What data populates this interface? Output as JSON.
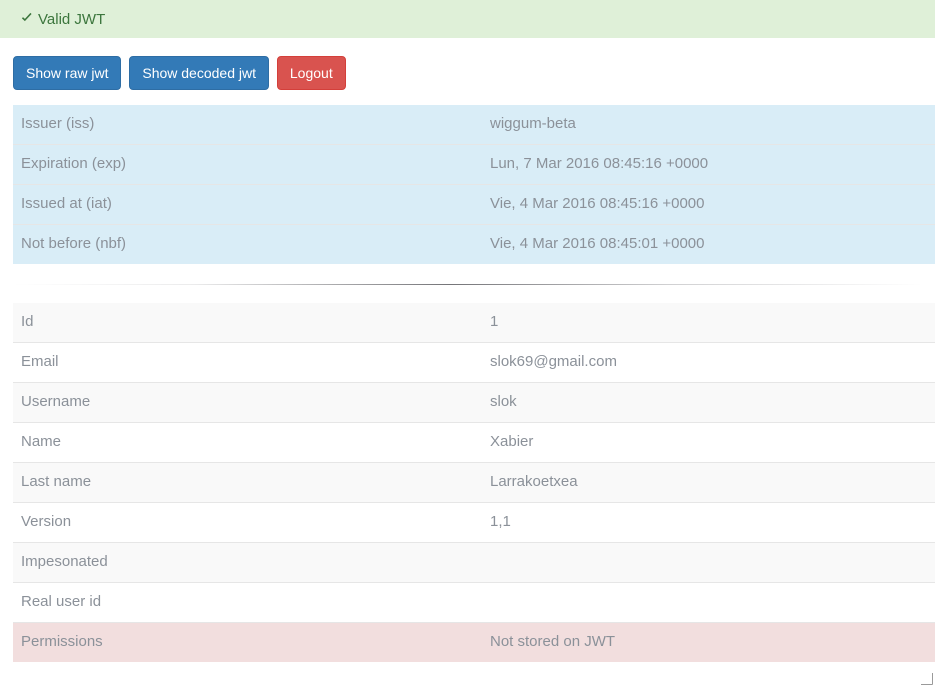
{
  "alert": {
    "icon": "check-icon",
    "text": "Valid JWT",
    "background_color": "#dff0d8",
    "text_color": "#3c763d"
  },
  "toolbar": {
    "show_raw_label": "Show raw jwt",
    "show_decoded_label": "Show decoded jwt",
    "logout_label": "Logout",
    "primary_color": "#337ab7",
    "danger_color": "#d9534f"
  },
  "claims_table": {
    "background_color": "#d9edf7",
    "rows": [
      {
        "label": "Issuer (iss)",
        "value": "wiggum-beta"
      },
      {
        "label": "Expiration (exp)",
        "value": "Lun, 7 Mar 2016 08:45:16 +0000"
      },
      {
        "label": "Issued at (iat)",
        "value": "Vie, 4 Mar 2016 08:45:16 +0000"
      },
      {
        "label": "Not before (nbf)",
        "value": "Vie, 4 Mar 2016 08:45:01 +0000"
      }
    ]
  },
  "user_table": {
    "danger_color": "#f2dede",
    "rows": [
      {
        "label": "Id",
        "value": "1",
        "state": "normal"
      },
      {
        "label": "Email",
        "value": "slok69@gmail.com",
        "state": "normal"
      },
      {
        "label": "Username",
        "value": "slok",
        "state": "normal"
      },
      {
        "label": "Name",
        "value": "Xabier",
        "state": "normal"
      },
      {
        "label": "Last name",
        "value": "Larrakoetxea",
        "state": "normal"
      },
      {
        "label": "Version",
        "value": "1,1",
        "state": "normal"
      },
      {
        "label": "Impesonated",
        "value": "",
        "state": "normal"
      },
      {
        "label": "Real user id",
        "value": "",
        "state": "normal"
      },
      {
        "label": "Permissions",
        "value": "Not stored on JWT",
        "state": "danger"
      }
    ]
  }
}
